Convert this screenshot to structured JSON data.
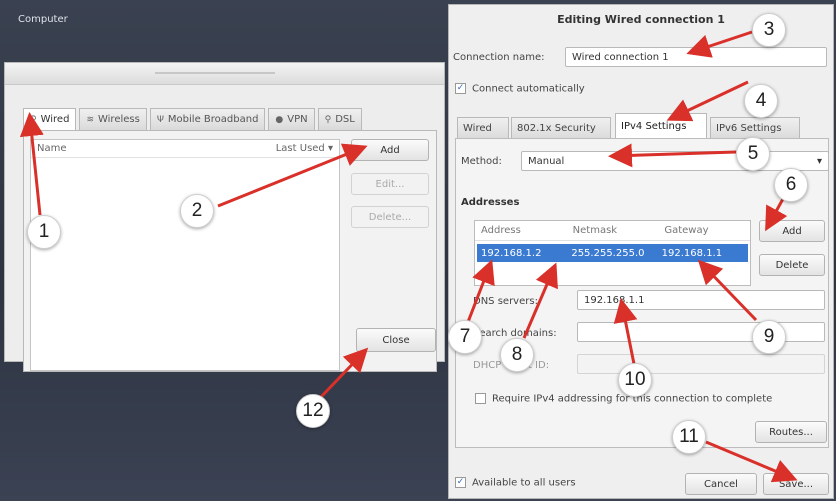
{
  "desktop": {
    "label": "Computer"
  },
  "left_window": {
    "tabs": [
      {
        "label": "Wired",
        "icon": "plug-icon"
      },
      {
        "label": "Wireless",
        "icon": "wifi-icon"
      },
      {
        "label": "Mobile Broadband",
        "icon": "antenna-icon"
      },
      {
        "label": "VPN",
        "icon": "lock-icon"
      },
      {
        "label": "DSL",
        "icon": "plug-icon"
      }
    ],
    "list_header": {
      "name": "Name",
      "last_used": "Last Used"
    },
    "buttons": {
      "add": "Add",
      "edit": "Edit...",
      "delete": "Delete...",
      "close": "Close"
    }
  },
  "right_window": {
    "title": "Editing Wired connection 1",
    "connection_name_label": "Connection name:",
    "connection_name_value": "Wired connection 1",
    "connect_automatically": "Connect automatically",
    "tabs": [
      "Wired",
      "802.1x Security",
      "IPv4 Settings",
      "IPv6 Settings"
    ],
    "active_tab": "IPv4 Settings",
    "method_label": "Method:",
    "method_value": "Manual",
    "addresses_label": "Addresses",
    "addresses_columns": [
      "Address",
      "Netmask",
      "Gateway"
    ],
    "addresses_rows": [
      {
        "address": "192.168.1.2",
        "netmask": "255.255.255.0",
        "gateway": "192.168.1.1"
      }
    ],
    "add_button": "Add",
    "delete_button": "Delete",
    "dns_label": "DNS servers:",
    "dns_value": "192.168.1.1",
    "search_label": "Search domains:",
    "dhcp_label": "DHCP client ID:",
    "require_ipv4": "Require IPv4 addressing for this connection to complete",
    "routes_button": "Routes...",
    "available_to_all": "Available to all users",
    "cancel_button": "Cancel",
    "save_button": "Save..."
  },
  "callouts": [
    "1",
    "2",
    "3",
    "4",
    "5",
    "6",
    "7",
    "8",
    "9",
    "10",
    "11",
    "12"
  ],
  "colors": {
    "arrow": "#d9302a",
    "selection": "#3b7ad1"
  }
}
